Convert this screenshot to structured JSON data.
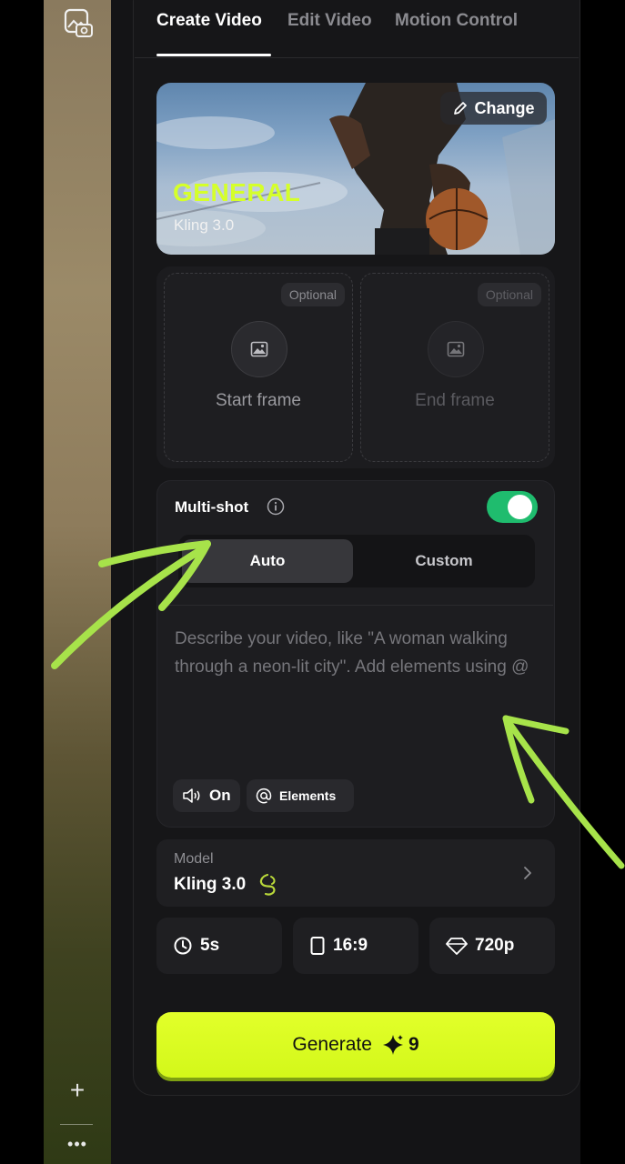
{
  "tabs": [
    {
      "label": "Create Video",
      "active": true
    },
    {
      "label": "Edit Video",
      "active": false
    },
    {
      "label": "Motion Control",
      "active": false
    }
  ],
  "banner": {
    "change_label": "Change",
    "title": "GENERAL",
    "subtitle": "Kling 3.0"
  },
  "frames": {
    "optional_label": "Optional",
    "start_label": "Start frame",
    "end_label": "End frame"
  },
  "multishot": {
    "label": "Multi-shot",
    "enabled": true,
    "toggle_color": "#1fbc6e",
    "modes": [
      "Auto",
      "Custom"
    ],
    "selected_mode": "Auto"
  },
  "prompt": {
    "placeholder": "Describe your video, like \"A woman walking through a neon-lit city\". Add elements using @"
  },
  "chips": {
    "sound_label": "On",
    "elements_label": "Elements"
  },
  "model": {
    "small_label": "Model",
    "name": "Kling 3.0"
  },
  "options": {
    "duration": "5s",
    "ratio": "16:9",
    "resolution": "720p"
  },
  "generate": {
    "label": "Generate",
    "cost": "9",
    "color": "#d9ff20"
  },
  "icons": {
    "rail_top": "photo-camera-icon",
    "rail_add": "plus-icon",
    "rail_more": "more-dots-icon"
  }
}
